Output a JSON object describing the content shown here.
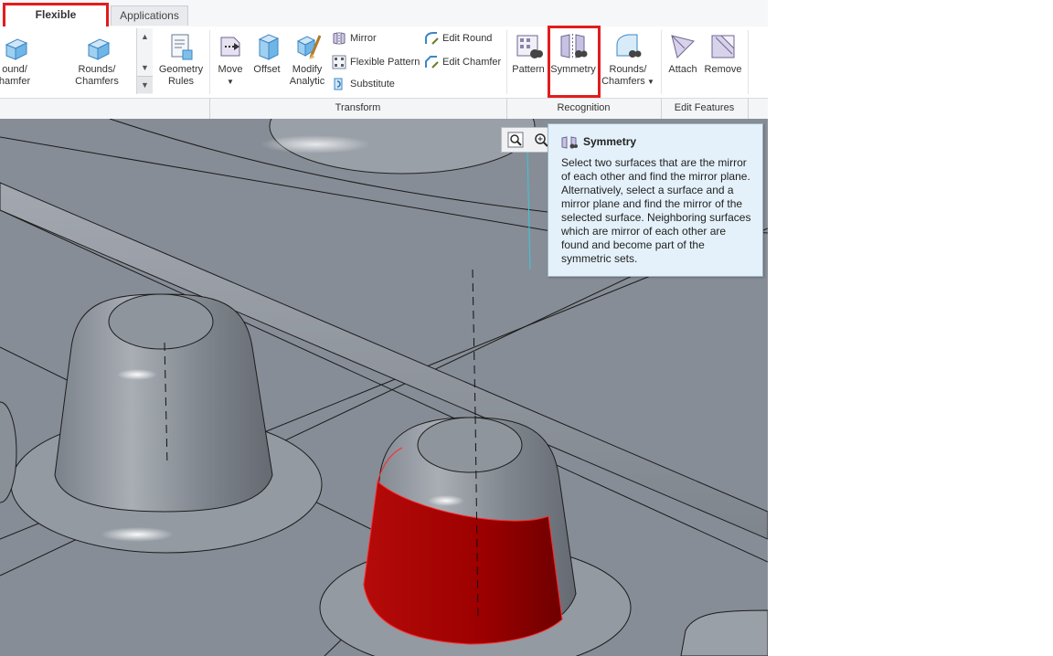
{
  "tabs": [
    {
      "label": "Flexible Modeling",
      "active": true
    },
    {
      "label": "Applications",
      "active": false
    }
  ],
  "ribbon": {
    "gallery": {
      "item1_line1": "ound/",
      "item1_line2": "hamfer",
      "item2_line1": "Rounds/",
      "item2_line2": "Chamfers"
    },
    "geometry_rules": {
      "line1": "Geometry",
      "line2": "Rules"
    },
    "transform": {
      "move": "Move",
      "offset": "Offset",
      "modify_analytic_line1": "Modify",
      "modify_analytic_line2": "Analytic",
      "mirror": "Mirror",
      "flexible_pattern": "Flexible Pattern",
      "substitute": "Substitute",
      "edit_round": "Edit Round",
      "edit_chamfer": "Edit Chamfer"
    },
    "recognition": {
      "pattern": "Pattern",
      "symmetry": "Symmetry",
      "rounds_chamfers_line1": "Rounds/",
      "rounds_chamfers_line2": "Chamfers"
    },
    "edit_features": {
      "attach": "Attach",
      "remove": "Remove"
    },
    "group_labels": {
      "transform": "Transform",
      "recognition": "Recognition",
      "edit_features": "Edit Features"
    }
  },
  "tooltip": {
    "title": "Symmetry",
    "body": "Select two surfaces that are the mirror of each other and find the mirror plane. Alternatively, select a surface and a mirror plane and find the mirror of the selected surface. Neighboring surfaces which are mirror of each other are found and become part of the symmetric sets."
  },
  "colors": {
    "highlight_box": "#e21c1c",
    "selected_surface": "#b00000",
    "viewport_bg": "#878d96",
    "tooltip_bg": "#e4f1fa"
  },
  "icons": [
    "round-chamfer-icon",
    "rounds-chamfers-icon",
    "geometry-rules-icon",
    "move-icon",
    "offset-icon",
    "modify-analytic-icon",
    "mirror-icon",
    "flexible-pattern-icon",
    "substitute-icon",
    "edit-round-icon",
    "edit-chamfer-icon",
    "pattern-icon",
    "symmetry-icon",
    "recognize-rounds-icon",
    "attach-icon",
    "remove-icon",
    "zoom-fit-icon",
    "zoom-in-icon"
  ]
}
